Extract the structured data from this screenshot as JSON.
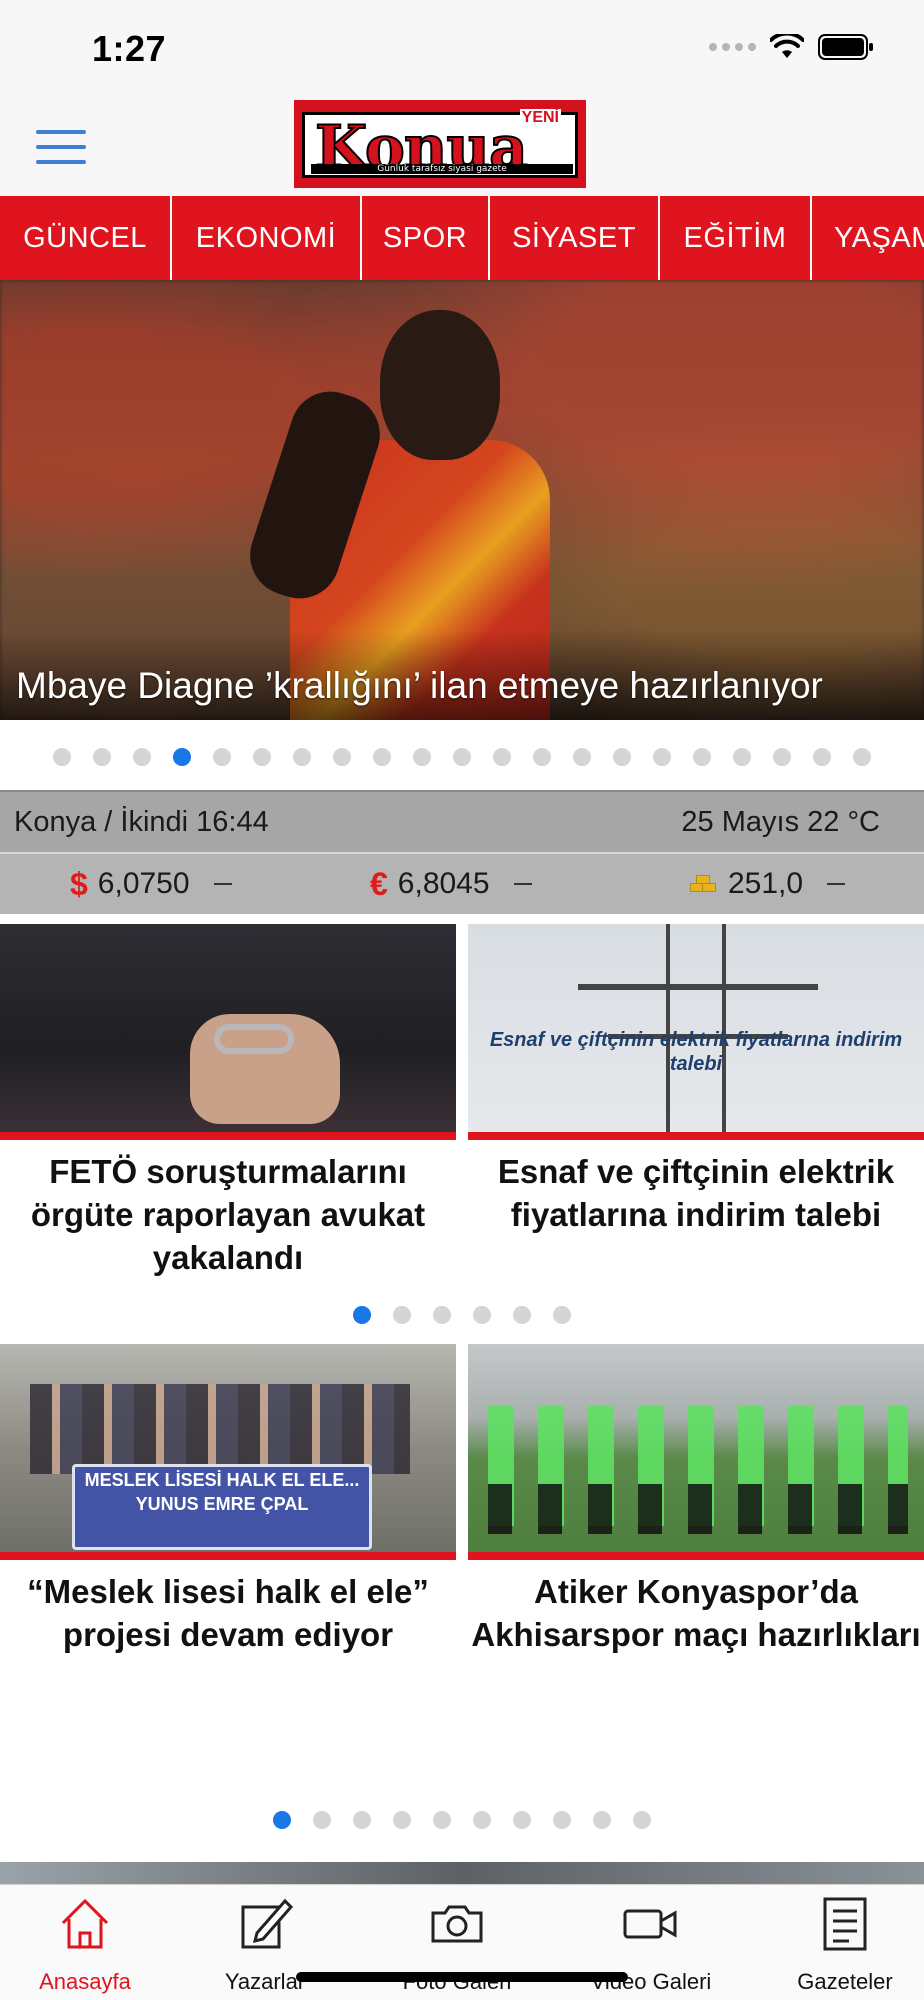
{
  "status_bar": {
    "time": "1:27"
  },
  "header": {
    "logo": {
      "main": "Konua",
      "yeni": "YENİ",
      "tagline": "Günlük tarafsız siyasi gazete"
    }
  },
  "categories": [
    "GÜNCEL",
    "EKONOMİ",
    "SPOR",
    "SİYASET",
    "EĞİTİM",
    "YAŞAM"
  ],
  "hero": {
    "caption": "Mbaye Diagne ’krallığını’ ilan etmeye hazırlanıyor",
    "dot_count": 21,
    "active_dot": 3
  },
  "info": {
    "location_prayer": "Konya / İkindi 16:44",
    "date_weather": "25 Mayıs 22 °C"
  },
  "currencies": [
    {
      "symbol": "$",
      "value": "6,0750",
      "icon": "dollar-icon"
    },
    {
      "symbol": "€",
      "value": "6,8045",
      "icon": "euro-icon"
    },
    {
      "symbol": "",
      "value": "251,0",
      "icon": "gold-bars-icon"
    }
  ],
  "cards_row1": [
    {
      "title": "FETÖ soruşturmalarını örgüte raporlayan avukat yakalandı"
    },
    {
      "title": "Esnaf ve çiftçinin elektrik fiyatlarına indirim talebi",
      "image_text": "Esnaf ve çiftçinin elektrik fiyatlarına indirim talebi"
    }
  ],
  "row1_dots": {
    "count": 6,
    "active": 0
  },
  "cards_row2": [
    {
      "title": "“Meslek lisesi halk el ele” projesi devam ediyor",
      "image_text": "MESLEK LİSESİ HALK EL ELE... YUNUS EMRE ÇPAL"
    },
    {
      "title": "Atiker Konyaspor’da Akhisarspor maçı hazırlıkları"
    }
  ],
  "row2_dots": {
    "count": 10,
    "active": 0
  },
  "tabs": [
    {
      "label": "Anasayfa",
      "icon": "home-icon",
      "active": true
    },
    {
      "label": "Yazarlar",
      "icon": "pencil-icon",
      "active": false
    },
    {
      "label": "Foto Galeri",
      "icon": "camera-icon",
      "active": false
    },
    {
      "label": "Video Galeri",
      "icon": "video-camera-icon",
      "active": false
    },
    {
      "label": "Gazeteler",
      "icon": "newspaper-icon",
      "active": false
    }
  ],
  "colors": {
    "brand_red": "#e0141e",
    "link_blue": "#1877e6",
    "menu_blue": "#3f7fd6",
    "info_gray": "#a6a6a6"
  }
}
